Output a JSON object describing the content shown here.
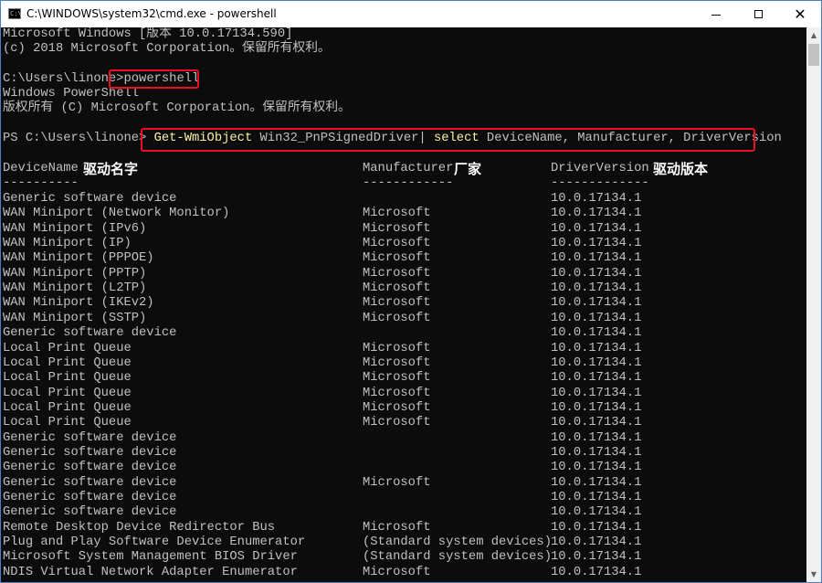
{
  "window": {
    "title": "C:\\WINDOWS\\system32\\cmd.exe - powershell",
    "icon": "cmd-icon",
    "icon_text": "C:\\",
    "minimize_glyph": "minimize-icon",
    "maximize_glyph": "maximize-icon",
    "close_glyph": "✕"
  },
  "console": {
    "header_lines": [
      "Microsoft Windows [版本 10.0.17134.590]",
      "(c) 2018 Microsoft Corporation。保留所有权利。",
      "",
      "C:\\Users\\linone>powershell",
      "Windows PowerShell",
      "版权所有 (C) Microsoft Corporation。保留所有权利。",
      "",
      "PS C:\\Users\\linone> Get-WmiObject Win32_PnPSignedDriver| select DeviceName, Manufacturer, DriverVersion"
    ],
    "prompt_cmd": {
      "prefix": "C:\\Users\\linone>",
      "command": "powershell"
    },
    "ps_cmd": {
      "prompt": "PS C:\\Users\\linone> ",
      "cmdlet": "Get-WmiObject",
      "args": " Win32_PnPSignedDriver| ",
      "select": "select",
      "params": " DeviceName, Manufacturer, DriverVersion"
    },
    "lines": {
      "l0": "Microsoft Windows [版本 10.0.17134.590]",
      "l1": "(c) 2018 Microsoft Corporation。保留所有权利。",
      "l4": "Windows PowerShell",
      "l5": "版权所有 (C) Microsoft Corporation。保留所有权利。"
    },
    "columns": {
      "name": "DeviceName",
      "manufacturer": "Manufacturer",
      "version": "DriverVersion",
      "name_rule": "----------",
      "manufacturer_rule": "------------",
      "version_rule": "-------------"
    },
    "annotations": {
      "name": "驱动名字",
      "manufacturer": "厂家",
      "version": "驱动版本"
    },
    "rows": [
      {
        "name": "Generic software device",
        "mfr": "",
        "ver": "10.0.17134.1"
      },
      {
        "name": "WAN Miniport (Network Monitor)",
        "mfr": "Microsoft",
        "ver": "10.0.17134.1"
      },
      {
        "name": "WAN Miniport (IPv6)",
        "mfr": "Microsoft",
        "ver": "10.0.17134.1"
      },
      {
        "name": "WAN Miniport (IP)",
        "mfr": "Microsoft",
        "ver": "10.0.17134.1"
      },
      {
        "name": "WAN Miniport (PPPOE)",
        "mfr": "Microsoft",
        "ver": "10.0.17134.1"
      },
      {
        "name": "WAN Miniport (PPTP)",
        "mfr": "Microsoft",
        "ver": "10.0.17134.1"
      },
      {
        "name": "WAN Miniport (L2TP)",
        "mfr": "Microsoft",
        "ver": "10.0.17134.1"
      },
      {
        "name": "WAN Miniport (IKEv2)",
        "mfr": "Microsoft",
        "ver": "10.0.17134.1"
      },
      {
        "name": "WAN Miniport (SSTP)",
        "mfr": "Microsoft",
        "ver": "10.0.17134.1"
      },
      {
        "name": "Generic software device",
        "mfr": "",
        "ver": "10.0.17134.1"
      },
      {
        "name": "Local Print Queue",
        "mfr": "Microsoft",
        "ver": "10.0.17134.1"
      },
      {
        "name": "Local Print Queue",
        "mfr": "Microsoft",
        "ver": "10.0.17134.1"
      },
      {
        "name": "Local Print Queue",
        "mfr": "Microsoft",
        "ver": "10.0.17134.1"
      },
      {
        "name": "Local Print Queue",
        "mfr": "Microsoft",
        "ver": "10.0.17134.1"
      },
      {
        "name": "Local Print Queue",
        "mfr": "Microsoft",
        "ver": "10.0.17134.1"
      },
      {
        "name": "Local Print Queue",
        "mfr": "Microsoft",
        "ver": "10.0.17134.1"
      },
      {
        "name": "Generic software device",
        "mfr": "",
        "ver": "10.0.17134.1"
      },
      {
        "name": "Generic software device",
        "mfr": "",
        "ver": "10.0.17134.1"
      },
      {
        "name": "Generic software device",
        "mfr": "",
        "ver": "10.0.17134.1"
      },
      {
        "name": "Generic software device",
        "mfr": "Microsoft",
        "ver": "10.0.17134.1"
      },
      {
        "name": "Generic software device",
        "mfr": "",
        "ver": "10.0.17134.1"
      },
      {
        "name": "Generic software device",
        "mfr": "",
        "ver": "10.0.17134.1"
      },
      {
        "name": "Remote Desktop Device Redirector Bus",
        "mfr": "Microsoft",
        "ver": "10.0.17134.1"
      },
      {
        "name": "Plug and Play Software Device Enumerator",
        "mfr": "(Standard system devices)",
        "ver": "10.0.17134.1"
      },
      {
        "name": "Microsoft System Management BIOS Driver",
        "mfr": "(Standard system devices)",
        "ver": "10.0.17134.1"
      },
      {
        "name": "NDIS Virtual Network Adapter Enumerator",
        "mfr": "Microsoft",
        "ver": "10.0.17134.1"
      }
    ]
  },
  "colors": {
    "console_bg": "#0c0c0c",
    "console_text": "#c0c0c0",
    "command_yellow": "#f9f1a5",
    "highlight_red": "#e81123",
    "annotation_text": "#ffffff"
  },
  "scrollbar": {
    "up_glyph": "▲",
    "down_glyph": "▼"
  }
}
